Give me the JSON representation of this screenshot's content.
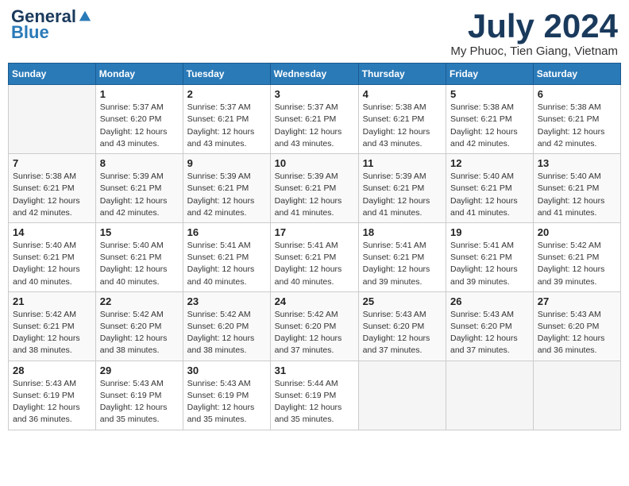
{
  "header": {
    "logo_general": "General",
    "logo_blue": "Blue",
    "month_year": "July 2024",
    "location": "My Phuoc, Tien Giang, Vietnam"
  },
  "days_of_week": [
    "Sunday",
    "Monday",
    "Tuesday",
    "Wednesday",
    "Thursday",
    "Friday",
    "Saturday"
  ],
  "weeks": [
    [
      {
        "day": "",
        "sunrise": "",
        "sunset": "",
        "daylight": "",
        "empty": true
      },
      {
        "day": "1",
        "sunrise": "5:37 AM",
        "sunset": "6:20 PM",
        "daylight": "12 hours and 43 minutes."
      },
      {
        "day": "2",
        "sunrise": "5:37 AM",
        "sunset": "6:21 PM",
        "daylight": "12 hours and 43 minutes."
      },
      {
        "day": "3",
        "sunrise": "5:37 AM",
        "sunset": "6:21 PM",
        "daylight": "12 hours and 43 minutes."
      },
      {
        "day": "4",
        "sunrise": "5:38 AM",
        "sunset": "6:21 PM",
        "daylight": "12 hours and 43 minutes."
      },
      {
        "day": "5",
        "sunrise": "5:38 AM",
        "sunset": "6:21 PM",
        "daylight": "12 hours and 42 minutes."
      },
      {
        "day": "6",
        "sunrise": "5:38 AM",
        "sunset": "6:21 PM",
        "daylight": "12 hours and 42 minutes."
      }
    ],
    [
      {
        "day": "7",
        "sunrise": "5:38 AM",
        "sunset": "6:21 PM",
        "daylight": "12 hours and 42 minutes."
      },
      {
        "day": "8",
        "sunrise": "5:39 AM",
        "sunset": "6:21 PM",
        "daylight": "12 hours and 42 minutes."
      },
      {
        "day": "9",
        "sunrise": "5:39 AM",
        "sunset": "6:21 PM",
        "daylight": "12 hours and 42 minutes."
      },
      {
        "day": "10",
        "sunrise": "5:39 AM",
        "sunset": "6:21 PM",
        "daylight": "12 hours and 41 minutes."
      },
      {
        "day": "11",
        "sunrise": "5:39 AM",
        "sunset": "6:21 PM",
        "daylight": "12 hours and 41 minutes."
      },
      {
        "day": "12",
        "sunrise": "5:40 AM",
        "sunset": "6:21 PM",
        "daylight": "12 hours and 41 minutes."
      },
      {
        "day": "13",
        "sunrise": "5:40 AM",
        "sunset": "6:21 PM",
        "daylight": "12 hours and 41 minutes."
      }
    ],
    [
      {
        "day": "14",
        "sunrise": "5:40 AM",
        "sunset": "6:21 PM",
        "daylight": "12 hours and 40 minutes."
      },
      {
        "day": "15",
        "sunrise": "5:40 AM",
        "sunset": "6:21 PM",
        "daylight": "12 hours and 40 minutes."
      },
      {
        "day": "16",
        "sunrise": "5:41 AM",
        "sunset": "6:21 PM",
        "daylight": "12 hours and 40 minutes."
      },
      {
        "day": "17",
        "sunrise": "5:41 AM",
        "sunset": "6:21 PM",
        "daylight": "12 hours and 40 minutes."
      },
      {
        "day": "18",
        "sunrise": "5:41 AM",
        "sunset": "6:21 PM",
        "daylight": "12 hours and 39 minutes."
      },
      {
        "day": "19",
        "sunrise": "5:41 AM",
        "sunset": "6:21 PM",
        "daylight": "12 hours and 39 minutes."
      },
      {
        "day": "20",
        "sunrise": "5:42 AM",
        "sunset": "6:21 PM",
        "daylight": "12 hours and 39 minutes."
      }
    ],
    [
      {
        "day": "21",
        "sunrise": "5:42 AM",
        "sunset": "6:21 PM",
        "daylight": "12 hours and 38 minutes."
      },
      {
        "day": "22",
        "sunrise": "5:42 AM",
        "sunset": "6:20 PM",
        "daylight": "12 hours and 38 minutes."
      },
      {
        "day": "23",
        "sunrise": "5:42 AM",
        "sunset": "6:20 PM",
        "daylight": "12 hours and 38 minutes."
      },
      {
        "day": "24",
        "sunrise": "5:42 AM",
        "sunset": "6:20 PM",
        "daylight": "12 hours and 37 minutes."
      },
      {
        "day": "25",
        "sunrise": "5:43 AM",
        "sunset": "6:20 PM",
        "daylight": "12 hours and 37 minutes."
      },
      {
        "day": "26",
        "sunrise": "5:43 AM",
        "sunset": "6:20 PM",
        "daylight": "12 hours and 37 minutes."
      },
      {
        "day": "27",
        "sunrise": "5:43 AM",
        "sunset": "6:20 PM",
        "daylight": "12 hours and 36 minutes."
      }
    ],
    [
      {
        "day": "28",
        "sunrise": "5:43 AM",
        "sunset": "6:19 PM",
        "daylight": "12 hours and 36 minutes."
      },
      {
        "day": "29",
        "sunrise": "5:43 AM",
        "sunset": "6:19 PM",
        "daylight": "12 hours and 35 minutes."
      },
      {
        "day": "30",
        "sunrise": "5:43 AM",
        "sunset": "6:19 PM",
        "daylight": "12 hours and 35 minutes."
      },
      {
        "day": "31",
        "sunrise": "5:44 AM",
        "sunset": "6:19 PM",
        "daylight": "12 hours and 35 minutes."
      },
      {
        "day": "",
        "sunrise": "",
        "sunset": "",
        "daylight": "",
        "empty": true
      },
      {
        "day": "",
        "sunrise": "",
        "sunset": "",
        "daylight": "",
        "empty": true
      },
      {
        "day": "",
        "sunrise": "",
        "sunset": "",
        "daylight": "",
        "empty": true
      }
    ]
  ]
}
